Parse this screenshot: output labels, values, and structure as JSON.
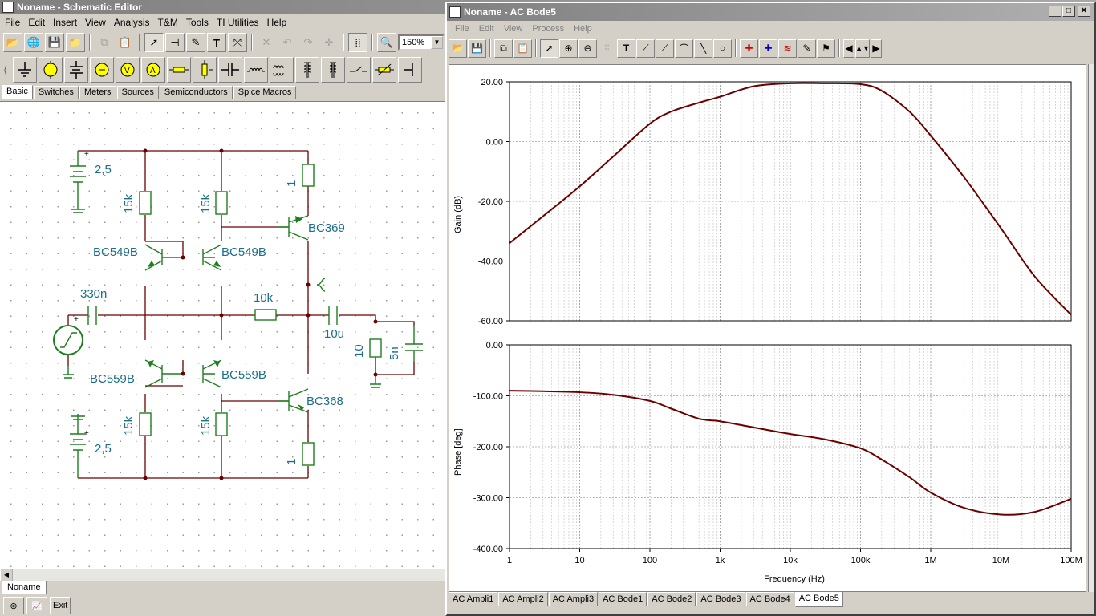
{
  "editor": {
    "title": "Noname - Schematic Editor",
    "menu": [
      "File",
      "Edit",
      "Insert",
      "View",
      "Analysis",
      "T&M",
      "Tools",
      "TI Utilities",
      "Help"
    ],
    "zoom": "150%",
    "component_tabs": [
      "Basic",
      "Switches",
      "Meters",
      "Sources",
      "Semiconductors",
      "Spice Macros"
    ],
    "doc_tab": "Noname",
    "exit_label": "Exit",
    "schematic_labels": {
      "bat_top": "2,5",
      "bat_bottom": "2,5",
      "r_top_left": "15k",
      "r_top_mid": "15k",
      "r_top_right": "1",
      "q1": "BC549B",
      "q2": "BC549B",
      "q3": "BC369",
      "c_in": "330n",
      "r_fb": "10k",
      "c_out": "10u",
      "r_load": "10",
      "c_load": "5n",
      "q4": "BC559B",
      "q5": "BC559B",
      "q6": "BC368",
      "r_bot_left": "15k",
      "r_bot_mid": "15k",
      "r_bot_right": "1"
    }
  },
  "bode": {
    "title": "Noname - AC Bode5",
    "menu": [
      "File",
      "Edit",
      "View",
      "Process",
      "Help"
    ],
    "tabs": [
      "AC Ampli1",
      "AC Ampli2",
      "AC Ampli3",
      "AC Bode1",
      "AC Bode2",
      "AC Bode3",
      "AC Bode4",
      "AC Bode5"
    ],
    "active_tab": "AC Bode5",
    "x_label": "Frequency (Hz)",
    "x_ticks": [
      "1",
      "10",
      "100",
      "1k",
      "10k",
      "100k",
      "1M",
      "10M",
      "100M"
    ]
  },
  "chart_data": [
    {
      "type": "line",
      "ylabel": "Gain (dB)",
      "xlabel": "Frequency (Hz)",
      "xscale": "log",
      "xlim": [
        1,
        100000000
      ],
      "ylim": [
        -60,
        20
      ],
      "yticks": [
        "20.00",
        "0.00",
        "-20.00",
        "-40.00",
        "-60.00"
      ],
      "color": "#6b0000",
      "grid": true,
      "x": [
        1,
        3,
        10,
        30,
        100,
        200,
        500,
        1000,
        3000,
        10000,
        30000,
        100000,
        200000,
        500000,
        1000000,
        3000000,
        10000000,
        30000000,
        100000000
      ],
      "values": [
        -34,
        -25,
        -15,
        -5,
        6,
        10,
        13,
        15,
        18.5,
        19.5,
        19.5,
        19.2,
        17,
        10,
        2,
        -12,
        -29,
        -45,
        -58
      ]
    },
    {
      "type": "line",
      "ylabel": "Phase [deg]",
      "xlabel": "Frequency (Hz)",
      "xscale": "log",
      "xlim": [
        1,
        100000000
      ],
      "ylim": [
        -400,
        0
      ],
      "yticks": [
        "0.00",
        "-100.00",
        "-200.00",
        "-300.00",
        "-400.00"
      ],
      "color": "#6b0000",
      "grid": true,
      "x": [
        1,
        3,
        10,
        30,
        100,
        200,
        500,
        1000,
        3000,
        10000,
        30000,
        100000,
        200000,
        500000,
        1000000,
        3000000,
        10000000,
        30000000,
        100000000
      ],
      "values": [
        -90,
        -91,
        -93,
        -98,
        -110,
        -125,
        -145,
        -150,
        -162,
        -175,
        -185,
        -203,
        -225,
        -260,
        -290,
        -320,
        -333,
        -328,
        -302
      ]
    }
  ]
}
